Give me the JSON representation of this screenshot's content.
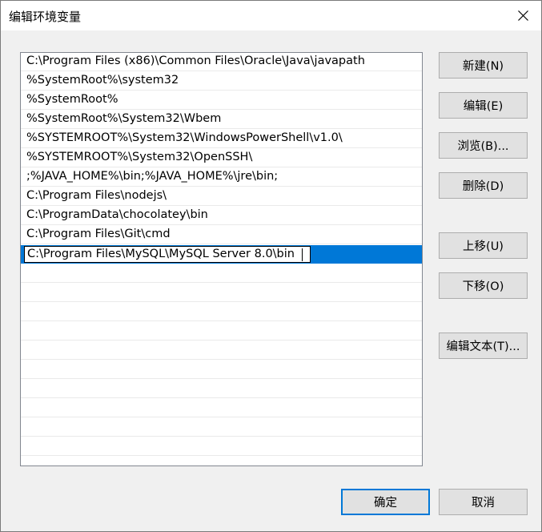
{
  "window": {
    "title": "编辑环境变量"
  },
  "paths": [
    "C:\\Program Files (x86)\\Common Files\\Oracle\\Java\\javapath",
    "%SystemRoot%\\system32",
    "%SystemRoot%",
    "%SystemRoot%\\System32\\Wbem",
    "%SYSTEMROOT%\\System32\\WindowsPowerShell\\v1.0\\",
    "%SYSTEMROOT%\\System32\\OpenSSH\\",
    ";%JAVA_HOME%\\bin;%JAVA_HOME%\\jre\\bin;",
    "C:\\Program Files\\nodejs\\",
    "C:\\ProgramData\\chocolatey\\bin",
    "C:\\Program Files\\Git\\cmd"
  ],
  "editing": {
    "value": "C:\\Program Files\\MySQL\\MySQL Server 8.0\\bin"
  },
  "buttons": {
    "new": "新建(N)",
    "edit": "编辑(E)",
    "browse": "浏览(B)...",
    "delete": "删除(D)",
    "move_up": "上移(U)",
    "move_down": "下移(O)",
    "edit_text": "编辑文本(T)...",
    "ok": "确定",
    "cancel": "取消"
  },
  "colors": {
    "accent": "#0078d7"
  }
}
